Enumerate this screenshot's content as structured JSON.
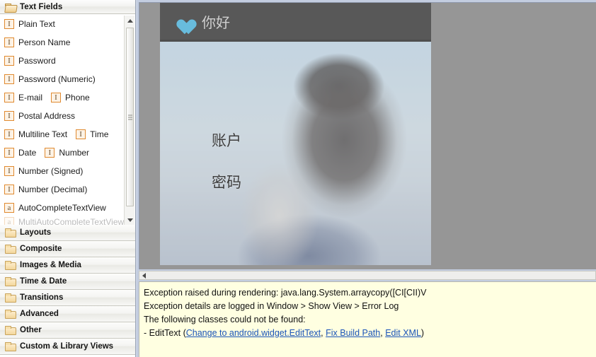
{
  "palette": {
    "header": {
      "title": "Text Fields",
      "icon": "folder-open-icon"
    },
    "items": [
      {
        "label": "Plain Text",
        "icon": "edittext-icon"
      },
      {
        "label": "Person Name",
        "icon": "edittext-icon"
      },
      {
        "label": "Password",
        "icon": "edittext-icon"
      },
      {
        "label": "Password (Numeric)",
        "icon": "edittext-icon"
      },
      {
        "label": "E-mail",
        "icon": "edittext-icon",
        "second_label": "Phone",
        "second_icon": "edittext-icon"
      },
      {
        "label": "Postal Address",
        "icon": "edittext-icon"
      },
      {
        "label": "Multiline Text",
        "icon": "edittext-icon",
        "second_label": "Time",
        "second_icon": "edittext-icon"
      },
      {
        "label": "Date",
        "icon": "edittext-icon",
        "second_label": "Number",
        "second_icon": "edittext-icon"
      },
      {
        "label": "Number (Signed)",
        "icon": "edittext-icon"
      },
      {
        "label": "Number (Decimal)",
        "icon": "edittext-icon"
      },
      {
        "label": "AutoCompleteTextView",
        "icon": "autocomplete-icon"
      },
      {
        "label": "MultiAutoCompleteTextView",
        "icon": "autocomplete-icon"
      }
    ],
    "categories": [
      {
        "label": "Layouts",
        "icon": "folder-icon"
      },
      {
        "label": "Composite",
        "icon": "folder-icon"
      },
      {
        "label": "Images & Media",
        "icon": "folder-icon"
      },
      {
        "label": "Time & Date",
        "icon": "folder-icon"
      },
      {
        "label": "Transitions",
        "icon": "folder-icon"
      },
      {
        "label": "Advanced",
        "icon": "folder-icon"
      },
      {
        "label": "Other",
        "icon": "folder-icon"
      },
      {
        "label": "Custom & Library Views",
        "icon": "folder-icon"
      }
    ],
    "scrollbar": {
      "up_arrow": "scroll-up-arrow-icon",
      "down_arrow": "scroll-down-arrow-icon"
    }
  },
  "preview": {
    "actionbar": {
      "icon": "heart-icon",
      "icon_color": "#68bcdd",
      "title": "你好",
      "background_color": "#585858"
    },
    "labels": {
      "account": "账户",
      "password": "密码"
    },
    "canvas_background": "#969696",
    "h_scrollbar": {
      "left_arrow": "scroll-left-arrow-icon"
    }
  },
  "errors": {
    "line1": "Exception raised during rendering: java.lang.System.arraycopy([CI[CII)V",
    "line2": "Exception details are logged in Window > Show View > Error Log",
    "line3": "The following classes could not be found:",
    "line4_prefix": "- EditText (",
    "link1": "Change to android.widget.EditText",
    "sep1": ", ",
    "link2": "Fix Build Path",
    "sep2": ", ",
    "link3": "Edit XML",
    "line4_suffix": ")",
    "background_color": "#ffffe1",
    "link_color": "#1b54b8"
  }
}
